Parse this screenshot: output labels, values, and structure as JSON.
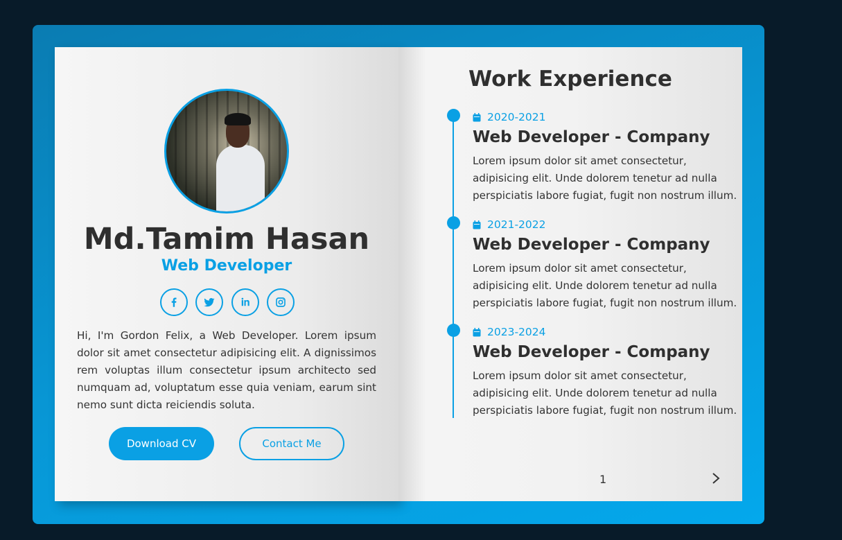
{
  "profile": {
    "name": "Md.Tamim Hasan",
    "role": "Web Developer",
    "bio": "Hi, I'm Gordon Felix, a Web Developer. Lorem ipsum dolor sit amet consectetur adipisicing elit. A dignissimos rem voluptas illum consectetur ipsum architecto sed numquam ad, voluptatum esse quia veniam, earum sint nemo sunt dicta reiciendis soluta.",
    "socials": [
      {
        "icon": "facebook-icon"
      },
      {
        "icon": "twitter-icon"
      },
      {
        "icon": "linkedin-icon"
      },
      {
        "icon": "instagram-icon"
      }
    ],
    "buttons": {
      "download": "Download CV",
      "contact": "Contact Me"
    }
  },
  "experience": {
    "title": "Work Experience",
    "items": [
      {
        "date": "2020-2021",
        "title": "Web Developer - Company",
        "description": "Lorem ipsum dolor sit amet consectetur, adipisicing elit. Unde dolorem tenetur ad nulla perspiciatis labore fugiat, fugit non nostrum illum."
      },
      {
        "date": "2021-2022",
        "title": "Web Developer - Company",
        "description": "Lorem ipsum dolor sit amet consectetur, adipisicing elit. Unde dolorem tenetur ad nulla perspiciatis labore fugiat, fugit non nostrum illum."
      },
      {
        "date": "2023-2024",
        "title": "Web Developer - Company",
        "description": "Lorem ipsum dolor sit amet consectetur, adipisicing elit. Unde dolorem tenetur ad nulla perspiciatis labore fugiat, fugit non nostrum illum."
      }
    ]
  },
  "pagination": {
    "page": "1",
    "next_icon": "chevron-right-icon"
  },
  "colors": {
    "accent": "#0aa0e4",
    "background": "#081b29",
    "text": "#2f2f2f"
  }
}
